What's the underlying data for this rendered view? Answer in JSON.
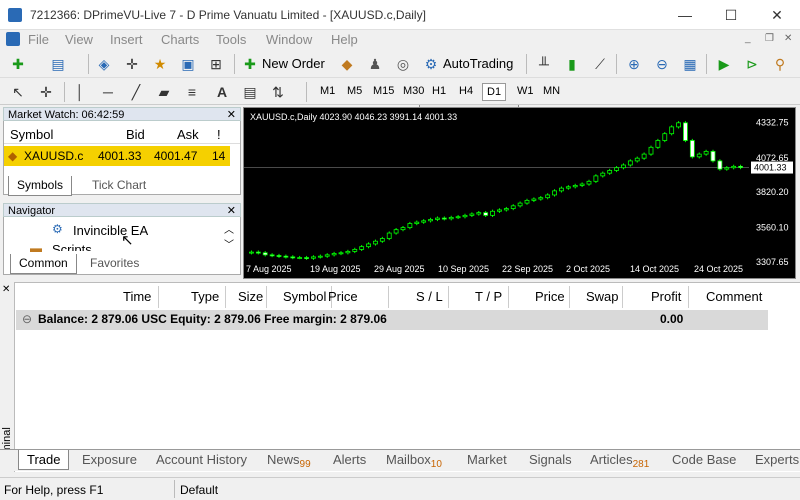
{
  "window": {
    "title": "7212366: DPrimeVU-Live 7 - D Prime Vanuatu Limited - [XAUUSD.c,Daily]",
    "min": "—",
    "max": "☐",
    "close": "✕"
  },
  "menu": [
    "File",
    "View",
    "Insert",
    "Charts",
    "Tools",
    "Window",
    "Help"
  ],
  "toolbar": {
    "new_order": "New Order",
    "autotrading": "AutoTrading"
  },
  "timeframes": [
    "M1",
    "M5",
    "M15",
    "M30",
    "H1",
    "H4",
    "D1",
    "W1",
    "MN"
  ],
  "active_timeframe": "D1",
  "market_watch": {
    "title": "Market Watch: 06:42:59",
    "headers": [
      "Symbol",
      "Bid",
      "Ask",
      "!"
    ],
    "row": {
      "symbol": "XAUUSD.c",
      "bid": "4001.33",
      "ask": "4001.47",
      "spread": "14"
    },
    "tabs": [
      "Symbols",
      "Tick Chart"
    ]
  },
  "navigator": {
    "title": "Navigator",
    "items": [
      "Invincible EA",
      "Scripts"
    ],
    "tabs": [
      "Common",
      "Favorites"
    ]
  },
  "chart": {
    "header": "XAUUSD.c,Daily  4023.90 4046.23 3991.14 4001.33",
    "price_marker": "4001.33",
    "y_ticks": [
      "4332.75",
      "4072.65",
      "3820.20",
      "3560.10",
      "3307.65"
    ],
    "x_ticks": [
      "7 Aug 2025",
      "19 Aug 2025",
      "29 Aug 2025",
      "10 Sep 2025",
      "22 Sep 2025",
      "2 Oct 2025",
      "14 Oct 2025",
      "24 Oct 2025"
    ]
  },
  "chart_data": {
    "type": "candlestick",
    "ylim": [
      3300,
      4380
    ],
    "x": [
      "7 Aug 2025",
      "19 Aug 2025",
      "29 Aug 2025",
      "10 Sep 2025",
      "22 Sep 2025",
      "2 Oct 2025",
      "14 Oct 2025",
      "24 Oct 2025"
    ],
    "series": [
      {
        "values": [
          3380,
          3375,
          3360,
          3355,
          3350,
          3345,
          3340,
          3340,
          3335,
          3345,
          3350,
          3360,
          3370,
          3375,
          3385,
          3400,
          3420,
          3440,
          3460,
          3480,
          3520,
          3545,
          3560,
          3590,
          3600,
          3610,
          3620,
          3630,
          3625,
          3635,
          3640,
          3650,
          3660,
          3670,
          3650,
          3680,
          3690,
          3700,
          3720,
          3740,
          3760,
          3770,
          3780,
          3800,
          3830,
          3850,
          3860,
          3870,
          3880,
          3900,
          3940,
          3960,
          3980,
          4000,
          4020,
          4050,
          4070,
          4100,
          4150,
          4200,
          4250,
          4300,
          4330,
          4200,
          4080,
          4100,
          4120,
          4050,
          3990,
          4000,
          4010,
          4001.33
        ]
      }
    ]
  },
  "terminal": {
    "label": "Terminal",
    "headers": [
      "Time",
      "Type",
      "Size",
      "Symbol",
      "Price",
      "S / L",
      "T / P",
      "Price",
      "Swap",
      "Profit",
      "Comment"
    ],
    "balance_line": "Balance: 2 879.06 USC  Equity: 2 879.06  Free margin: 2 879.06",
    "profit": "0.00",
    "tabs": [
      {
        "label": "Trade",
        "badge": ""
      },
      {
        "label": "Exposure",
        "badge": ""
      },
      {
        "label": "Account History",
        "badge": ""
      },
      {
        "label": "News",
        "badge": "99"
      },
      {
        "label": "Alerts",
        "badge": ""
      },
      {
        "label": "Mailbox",
        "badge": "10"
      },
      {
        "label": "Market",
        "badge": ""
      },
      {
        "label": "Signals",
        "badge": ""
      },
      {
        "label": "Articles",
        "badge": "281"
      },
      {
        "label": "Code Base",
        "badge": ""
      },
      {
        "label": "Experts",
        "badge": ""
      }
    ]
  },
  "status": {
    "help": "For Help, press F1",
    "profile": "Default"
  }
}
